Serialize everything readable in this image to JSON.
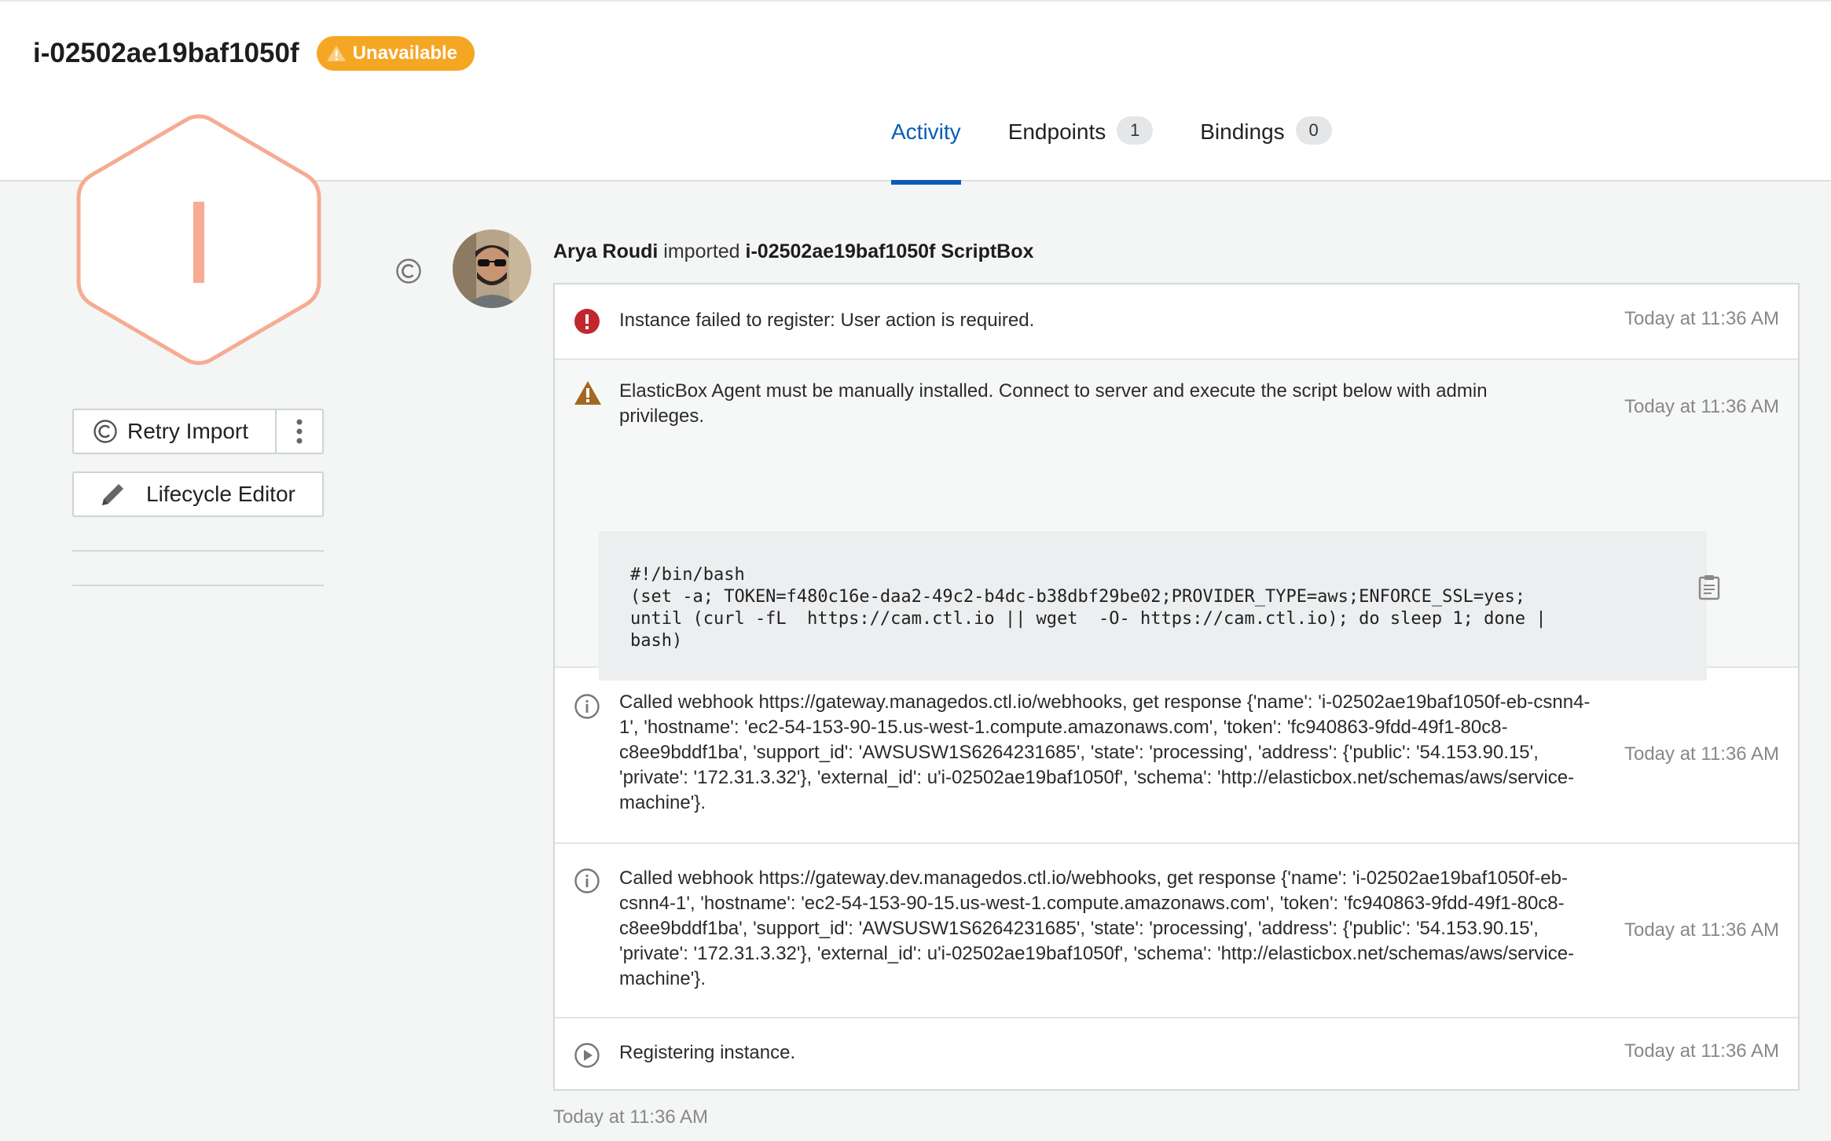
{
  "header": {
    "instance_name": "i-02502ae19baf1050f",
    "status_badge": "Unavailable",
    "badge_color": "#f5a623",
    "tabs": [
      {
        "label": "Activity",
        "count": null,
        "active": true
      },
      {
        "label": "Endpoints",
        "count": "1",
        "active": false
      },
      {
        "label": "Bindings",
        "count": "0",
        "active": false
      }
    ]
  },
  "sidebar": {
    "hexagon_letter": "I",
    "hexagon_color": "#f6ab93",
    "retry_label": "Retry Import",
    "lifecycle_label": "Lifecycle Editor"
  },
  "activity": {
    "actor": "Arya Roudi",
    "action": " imported ",
    "target": "i-02502ae19baf1050f ScriptBox",
    "entries": [
      {
        "type": "error",
        "text": "Instance failed to register: User action is required.",
        "time": "Today at 11:36 AM"
      },
      {
        "type": "warning",
        "text": "ElasticBox Agent must be manually installed. Connect to server and execute the script below with admin privileges.",
        "time": "Today at 11:36 AM",
        "script": "#!/bin/bash\n(set -a; TOKEN=f480c16e-daa2-49c2-b4dc-b38dbf29be02;PROVIDER_TYPE=aws;ENFORCE_SSL=yes;\nuntil (curl -fL  https://cam.ctl.io || wget  -O- https://cam.ctl.io); do sleep 1; done |\nbash)"
      },
      {
        "type": "info",
        "text": "Called webhook https://gateway.managedos.ctl.io/webhooks, get response {'name': 'i-02502ae19baf1050f-eb-csnn4-1', 'hostname': 'ec2-54-153-90-15.us-west-1.compute.amazonaws.com', 'token': 'fc940863-9fdd-49f1-80c8-c8ee9bddf1ba', 'support_id': 'AWSUSW1S6264231685', 'state': 'processing', 'address': {'public': '54.153.90.15', 'private': '172.31.3.32'}, 'external_id': u'i-02502ae19baf1050f', 'schema': 'http://elasticbox.net/schemas/aws/service-machine'}.",
        "time": "Today at 11:36 AM"
      },
      {
        "type": "info",
        "text": "Called webhook https://gateway.dev.managedos.ctl.io/webhooks, get response {'name': 'i-02502ae19baf1050f-eb-csnn4-1', 'hostname': 'ec2-54-153-90-15.us-west-1.compute.amazonaws.com', 'token': 'fc940863-9fdd-49f1-80c8-c8ee9bddf1ba', 'support_id': 'AWSUSW1S6264231685', 'state': 'processing', 'address': {'public': '54.153.90.15', 'private': '172.31.3.32'}, 'external_id': u'i-02502ae19baf1050f', 'schema': 'http://elasticbox.net/schemas/aws/service-machine'}.",
        "time": "Today at 11:36 AM"
      },
      {
        "type": "play",
        "text": "Registering instance.",
        "time": "Today at 11:36 AM"
      }
    ],
    "footer_time": "Today at 11:36 AM"
  }
}
